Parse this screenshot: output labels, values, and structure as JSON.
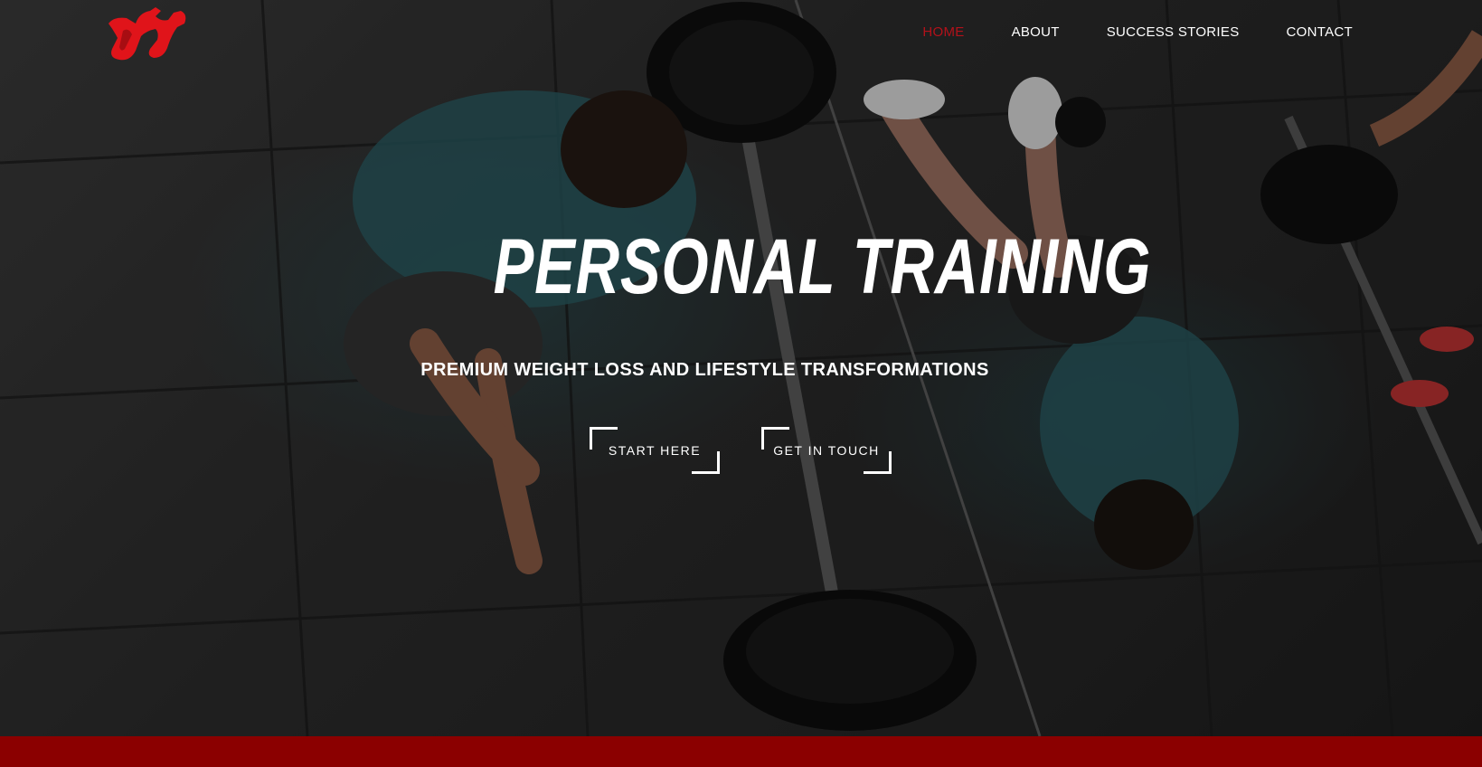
{
  "nav": {
    "items": [
      {
        "label": "HOME",
        "active": true
      },
      {
        "label": "ABOUT",
        "active": false
      },
      {
        "label": "SUCCESS STORIES",
        "active": false
      },
      {
        "label": "CONTACT",
        "active": false
      }
    ]
  },
  "hero": {
    "title": "PERSONAL TRAINING",
    "subtitle": "PREMIUM WEIGHT LOSS AND LIFESTYLE TRANSFORMATIONS",
    "primary_button": "START HERE",
    "secondary_button": "GET IN TOUCH"
  },
  "colors": {
    "accent": "#b3111a",
    "footer_bar": "#8b0000",
    "text": "#ffffff"
  },
  "icons": {
    "logo": "dumbbell-logo-icon"
  }
}
